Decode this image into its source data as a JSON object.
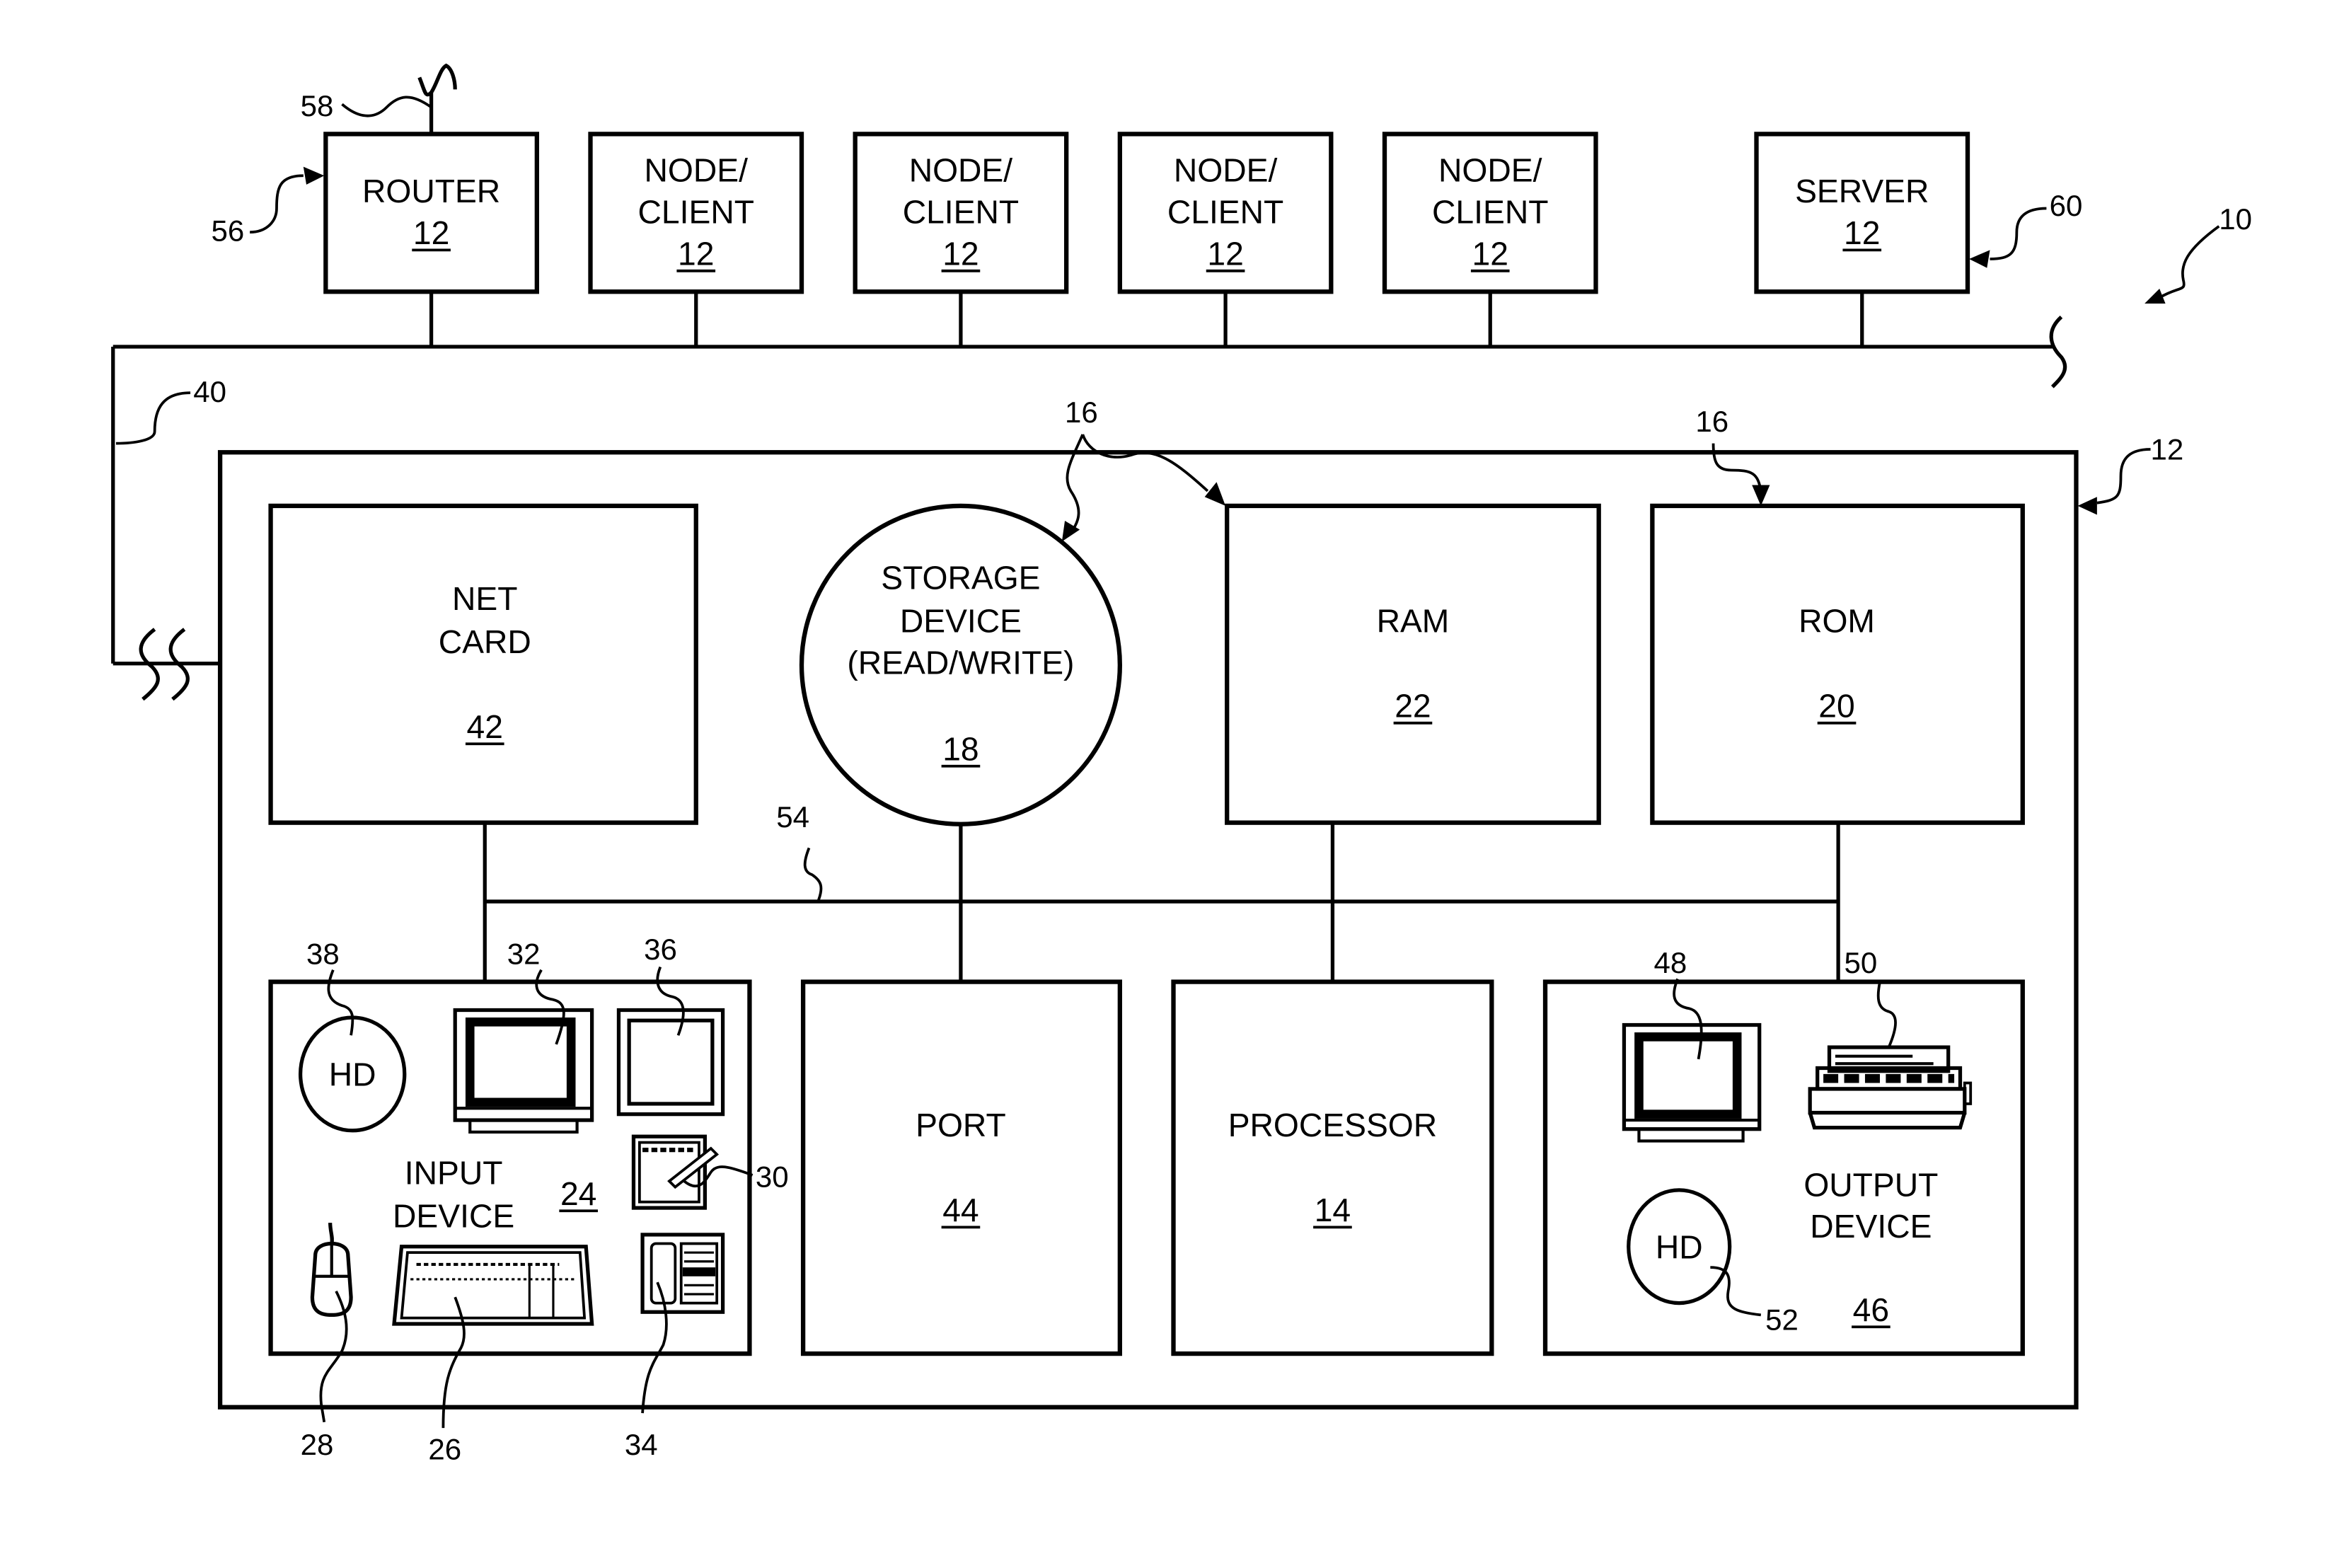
{
  "figure": {
    "system_ref": "10",
    "network": {
      "bus_ref": "40",
      "devices": [
        {
          "id": "router",
          "line1": "ROUTER",
          "line2": "",
          "ref": "12",
          "callout": "56"
        },
        {
          "id": "node1",
          "line1": "NODE/",
          "line2": "CLIENT",
          "ref": "12"
        },
        {
          "id": "node2",
          "line1": "NODE/",
          "line2": "CLIENT",
          "ref": "12"
        },
        {
          "id": "node3",
          "line1": "NODE/",
          "line2": "CLIENT",
          "ref": "12"
        },
        {
          "id": "node4",
          "line1": "NODE/",
          "line2": "CLIENT",
          "ref": "12"
        },
        {
          "id": "server",
          "line1": "SERVER",
          "line2": "",
          "ref": "12",
          "callout": "60"
        }
      ],
      "antenna_ref": "58"
    },
    "computer": {
      "ref": "12",
      "internal_bus_ref": "54",
      "memory_callout_ref": "16",
      "memory_callout_ref_2": "16",
      "net_card": {
        "line1": "NET",
        "line2": "CARD",
        "ref": "42"
      },
      "storage": {
        "line1": "STORAGE",
        "line2": "DEVICE",
        "line3": "(READ/WRITE)",
        "ref": "18"
      },
      "ram": {
        "label": "RAM",
        "ref": "22"
      },
      "rom": {
        "label": "ROM",
        "ref": "20"
      },
      "port": {
        "label": "PORT",
        "ref": "44"
      },
      "processor": {
        "label": "PROCESSOR",
        "ref": "14"
      },
      "input_device": {
        "line1": "INPUT",
        "line2": "DEVICE",
        "ref": "24",
        "hd_label": "HD",
        "refs": {
          "hd": "38",
          "monitor": "32",
          "touchscreen": "36",
          "tablet": "30",
          "mouse": "28",
          "keyboard": "26",
          "phone": "34"
        }
      },
      "output_device": {
        "line1": "OUTPUT",
        "line2": "DEVICE",
        "ref": "46",
        "hd_label": "HD",
        "refs": {
          "monitor": "48",
          "printer": "50",
          "hd": "52"
        }
      }
    }
  }
}
